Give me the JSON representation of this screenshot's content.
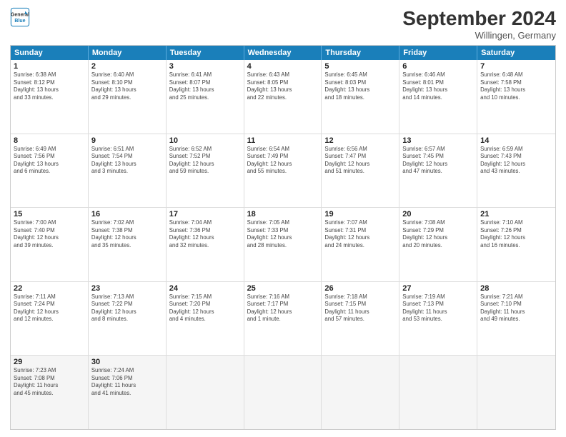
{
  "logo": {
    "line1": "General",
    "line2": "Blue"
  },
  "title": "September 2024",
  "location": "Willingen, Germany",
  "headers": [
    "Sunday",
    "Monday",
    "Tuesday",
    "Wednesday",
    "Thursday",
    "Friday",
    "Saturday"
  ],
  "rows": [
    [
      {
        "day": "",
        "text": ""
      },
      {
        "day": "2",
        "text": "Sunrise: 6:40 AM\nSunset: 8:10 PM\nDaylight: 13 hours\nand 29 minutes."
      },
      {
        "day": "3",
        "text": "Sunrise: 6:41 AM\nSunset: 8:07 PM\nDaylight: 13 hours\nand 25 minutes."
      },
      {
        "day": "4",
        "text": "Sunrise: 6:43 AM\nSunset: 8:05 PM\nDaylight: 13 hours\nand 22 minutes."
      },
      {
        "day": "5",
        "text": "Sunrise: 6:45 AM\nSunset: 8:03 PM\nDaylight: 13 hours\nand 18 minutes."
      },
      {
        "day": "6",
        "text": "Sunrise: 6:46 AM\nSunset: 8:01 PM\nDaylight: 13 hours\nand 14 minutes."
      },
      {
        "day": "7",
        "text": "Sunrise: 6:48 AM\nSunset: 7:58 PM\nDaylight: 13 hours\nand 10 minutes."
      }
    ],
    [
      {
        "day": "8",
        "text": "Sunrise: 6:49 AM\nSunset: 7:56 PM\nDaylight: 13 hours\nand 6 minutes."
      },
      {
        "day": "9",
        "text": "Sunrise: 6:51 AM\nSunset: 7:54 PM\nDaylight: 13 hours\nand 3 minutes."
      },
      {
        "day": "10",
        "text": "Sunrise: 6:52 AM\nSunset: 7:52 PM\nDaylight: 12 hours\nand 59 minutes."
      },
      {
        "day": "11",
        "text": "Sunrise: 6:54 AM\nSunset: 7:49 PM\nDaylight: 12 hours\nand 55 minutes."
      },
      {
        "day": "12",
        "text": "Sunrise: 6:56 AM\nSunset: 7:47 PM\nDaylight: 12 hours\nand 51 minutes."
      },
      {
        "day": "13",
        "text": "Sunrise: 6:57 AM\nSunset: 7:45 PM\nDaylight: 12 hours\nand 47 minutes."
      },
      {
        "day": "14",
        "text": "Sunrise: 6:59 AM\nSunset: 7:43 PM\nDaylight: 12 hours\nand 43 minutes."
      }
    ],
    [
      {
        "day": "15",
        "text": "Sunrise: 7:00 AM\nSunset: 7:40 PM\nDaylight: 12 hours\nand 39 minutes."
      },
      {
        "day": "16",
        "text": "Sunrise: 7:02 AM\nSunset: 7:38 PM\nDaylight: 12 hours\nand 35 minutes."
      },
      {
        "day": "17",
        "text": "Sunrise: 7:04 AM\nSunset: 7:36 PM\nDaylight: 12 hours\nand 32 minutes."
      },
      {
        "day": "18",
        "text": "Sunrise: 7:05 AM\nSunset: 7:33 PM\nDaylight: 12 hours\nand 28 minutes."
      },
      {
        "day": "19",
        "text": "Sunrise: 7:07 AM\nSunset: 7:31 PM\nDaylight: 12 hours\nand 24 minutes."
      },
      {
        "day": "20",
        "text": "Sunrise: 7:08 AM\nSunset: 7:29 PM\nDaylight: 12 hours\nand 20 minutes."
      },
      {
        "day": "21",
        "text": "Sunrise: 7:10 AM\nSunset: 7:26 PM\nDaylight: 12 hours\nand 16 minutes."
      }
    ],
    [
      {
        "day": "22",
        "text": "Sunrise: 7:11 AM\nSunset: 7:24 PM\nDaylight: 12 hours\nand 12 minutes."
      },
      {
        "day": "23",
        "text": "Sunrise: 7:13 AM\nSunset: 7:22 PM\nDaylight: 12 hours\nand 8 minutes."
      },
      {
        "day": "24",
        "text": "Sunrise: 7:15 AM\nSunset: 7:20 PM\nDaylight: 12 hours\nand 4 minutes."
      },
      {
        "day": "25",
        "text": "Sunrise: 7:16 AM\nSunset: 7:17 PM\nDaylight: 12 hours\nand 1 minute."
      },
      {
        "day": "26",
        "text": "Sunrise: 7:18 AM\nSunset: 7:15 PM\nDaylight: 11 hours\nand 57 minutes."
      },
      {
        "day": "27",
        "text": "Sunrise: 7:19 AM\nSunset: 7:13 PM\nDaylight: 11 hours\nand 53 minutes."
      },
      {
        "day": "28",
        "text": "Sunrise: 7:21 AM\nSunset: 7:10 PM\nDaylight: 11 hours\nand 49 minutes."
      }
    ],
    [
      {
        "day": "29",
        "text": "Sunrise: 7:23 AM\nSunset: 7:08 PM\nDaylight: 11 hours\nand 45 minutes."
      },
      {
        "day": "30",
        "text": "Sunrise: 7:24 AM\nSunset: 7:06 PM\nDaylight: 11 hours\nand 41 minutes."
      },
      {
        "day": "",
        "text": ""
      },
      {
        "day": "",
        "text": ""
      },
      {
        "day": "",
        "text": ""
      },
      {
        "day": "",
        "text": ""
      },
      {
        "day": "",
        "text": ""
      }
    ]
  ],
  "row0": [
    {
      "day": "1",
      "text": "Sunrise: 6:38 AM\nSunset: 8:12 PM\nDaylight: 13 hours\nand 33 minutes."
    },
    {
      "day": "2",
      "text": "Sunrise: 6:40 AM\nSunset: 8:10 PM\nDaylight: 13 hours\nand 29 minutes."
    },
    {
      "day": "3",
      "text": "Sunrise: 6:41 AM\nSunset: 8:07 PM\nDaylight: 13 hours\nand 25 minutes."
    },
    {
      "day": "4",
      "text": "Sunrise: 6:43 AM\nSunset: 8:05 PM\nDaylight: 13 hours\nand 22 minutes."
    },
    {
      "day": "5",
      "text": "Sunrise: 6:45 AM\nSunset: 8:03 PM\nDaylight: 13 hours\nand 18 minutes."
    },
    {
      "day": "6",
      "text": "Sunrise: 6:46 AM\nSunset: 8:01 PM\nDaylight: 13 hours\nand 14 minutes."
    },
    {
      "day": "7",
      "text": "Sunrise: 6:48 AM\nSunset: 7:58 PM\nDaylight: 13 hours\nand 10 minutes."
    }
  ]
}
